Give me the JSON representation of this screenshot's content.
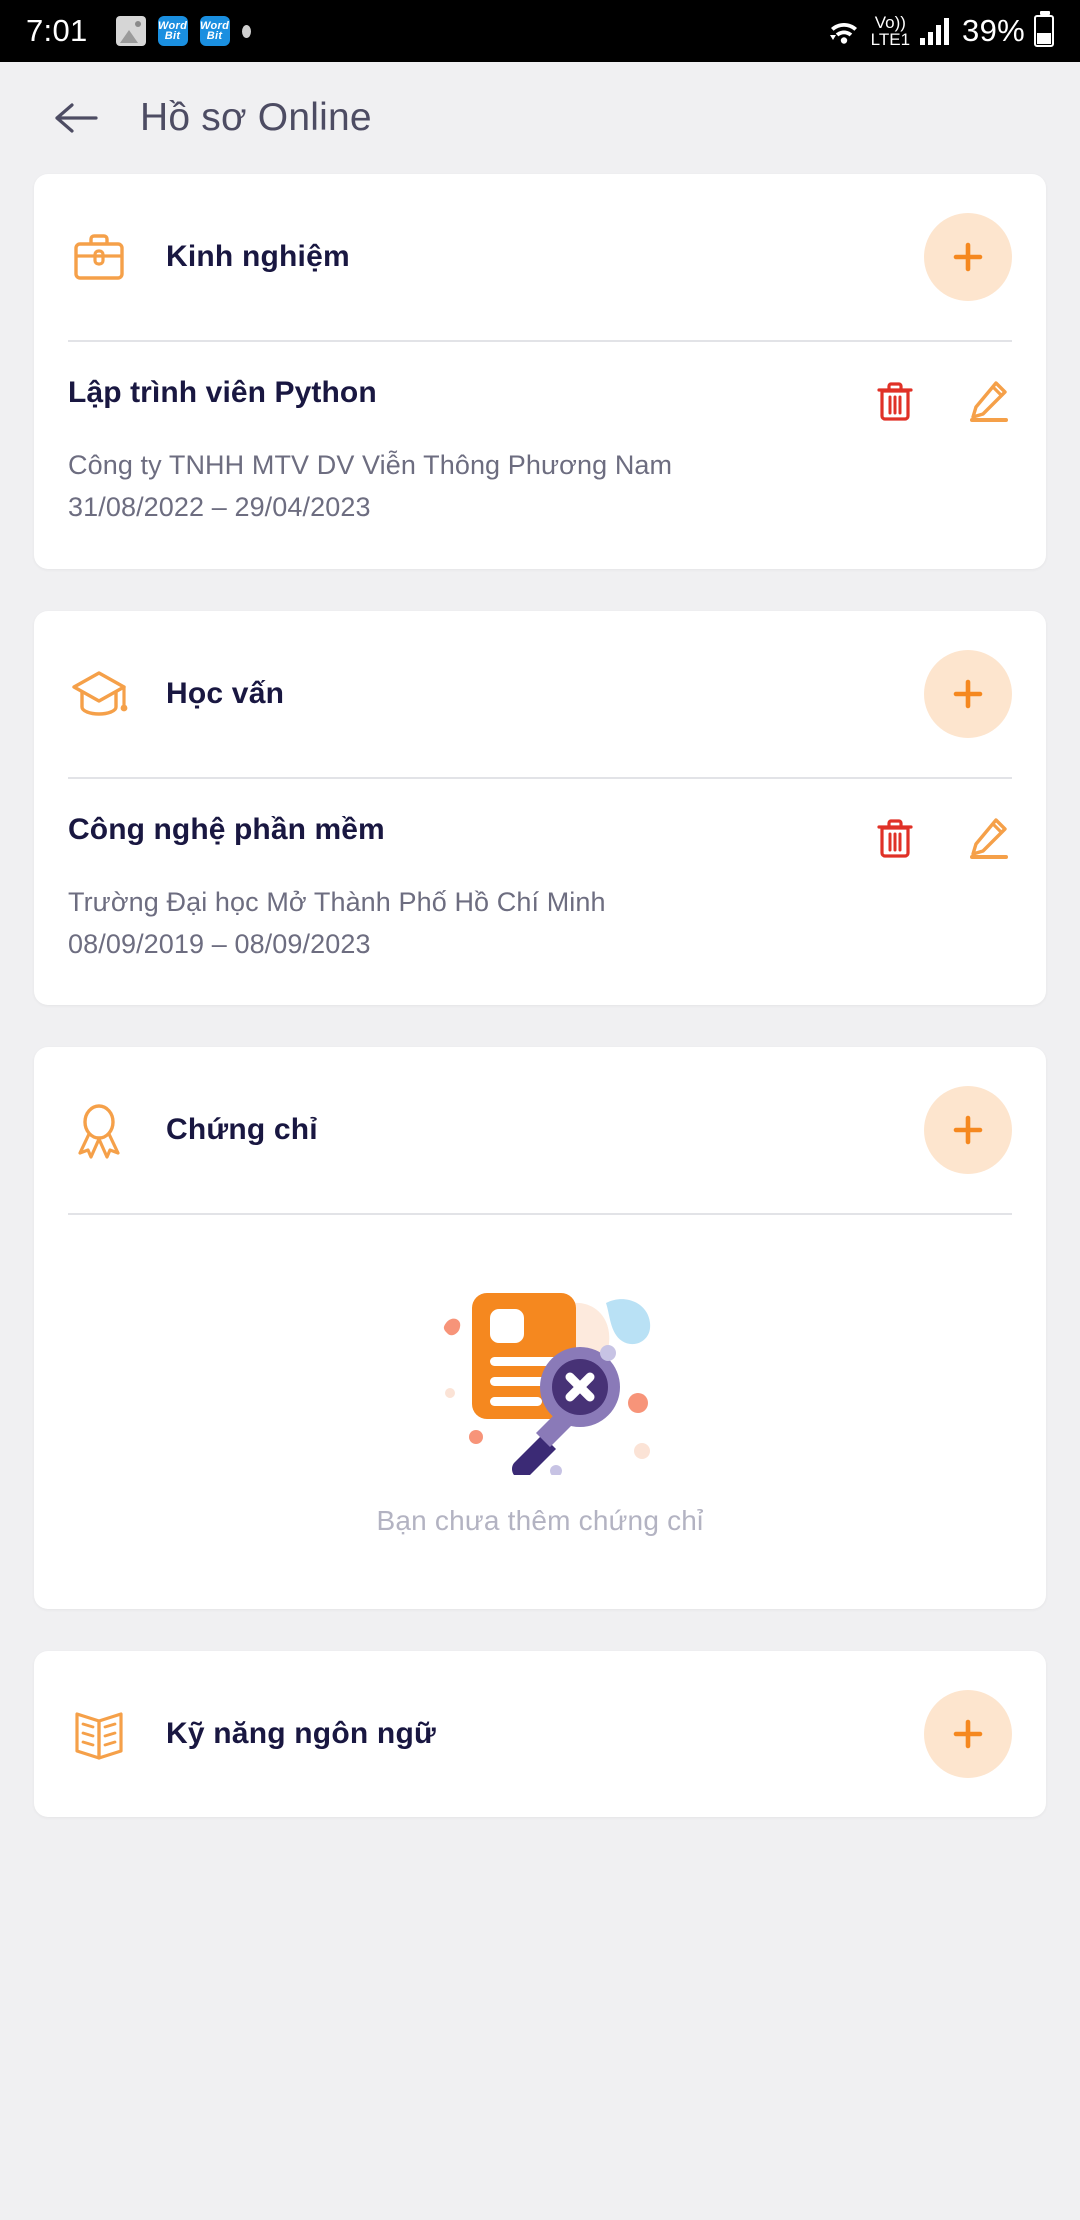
{
  "statusbar": {
    "time": "7:01",
    "photo_icon": "gallery-icon",
    "app_icon_1": "wordbit-icon",
    "app_icon_2": "wordbit-icon",
    "dot_icon": "dot-icon",
    "wifi_icon": "wifi-icon",
    "volte_top": "Vo))",
    "volte_bottom": "LTE1",
    "signal_icon": "signal-bars-icon",
    "battery_percent": "39%",
    "battery_icon": "battery-icon"
  },
  "header": {
    "back_icon": "back-arrow-icon",
    "title": "Hồ sơ Online"
  },
  "colors": {
    "background": "#f0f0f2",
    "card": "#ffffff",
    "accent_orange": "#f5a049",
    "accent_orange_strong": "#f5881f",
    "add_button_bg": "#fde5ce",
    "title_dark": "#191741",
    "header_title": "#4d4c63",
    "subtext": "#6d6d80",
    "empty_text": "#b3b3c2",
    "divider": "#e2e3e7",
    "delete_red": "#e03127",
    "magnifier_purple": "#7c6cb0",
    "magnifier_dark": "#473276"
  },
  "sections": [
    {
      "id": "experience",
      "icon": "briefcase-icon",
      "title": "Kinh nghiệm",
      "add_label": "+",
      "entries": [
        {
          "title": "Lập trình viên Python",
          "org": "Công ty TNHH MTV DV Viễn Thông Phương Nam",
          "dates": "31/08/2022 – 29/04/2023",
          "delete_icon": "trash-icon",
          "edit_icon": "pencil-icon"
        }
      ]
    },
    {
      "id": "education",
      "icon": "graduation-cap-icon",
      "title": "Học vấn",
      "add_label": "+",
      "entries": [
        {
          "title": "Công nghệ phần mềm",
          "org": "Trường Đại học Mở Thành Phố Hồ Chí Minh",
          "dates": "08/09/2019 – 08/09/2023",
          "delete_icon": "trash-icon",
          "edit_icon": "pencil-icon"
        }
      ]
    },
    {
      "id": "certificates",
      "icon": "award-ribbon-icon",
      "title": "Chứng chỉ",
      "add_label": "+",
      "entries": [],
      "empty_text": "Bạn chưa thêm chứng chỉ",
      "empty_illustration": "no-document-found-illustration"
    },
    {
      "id": "language-skills",
      "icon": "open-book-icon",
      "title": "Kỹ năng ngôn ngữ",
      "add_label": "+",
      "entries": []
    }
  ]
}
